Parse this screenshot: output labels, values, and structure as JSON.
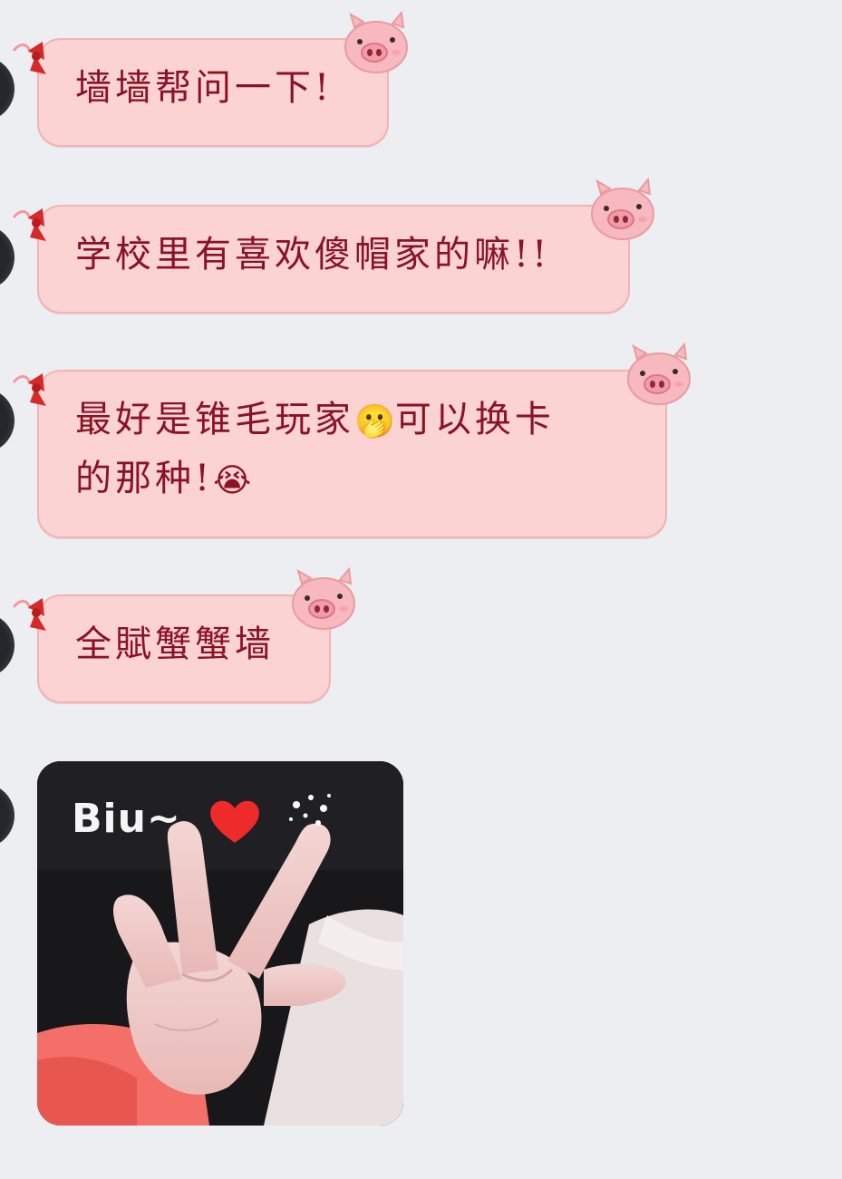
{
  "messages": [
    {
      "text": "墙墙帮问一下!"
    },
    {
      "text": "学校里有喜欢傻帽家的嘛!!"
    },
    {
      "text_before_emoji": "最好是锥毛玩家",
      "emoji1": "🫢",
      "text_mid": "可以换卡\n的那种!",
      "emoji2": "😭"
    },
    {
      "text": "全賦蟹蟹墙"
    }
  ],
  "image_message": {
    "caption": "Biu~",
    "heart_icon": "heart-icon",
    "sparkle_icon": "sparkle-icon",
    "subject": "hand making V / finger-heart gesture"
  },
  "decorations": {
    "bow_icon": "bow-icon",
    "pig_sticker": "pig-icon"
  },
  "colors": {
    "background": "#eceef2",
    "bubble_fill": "#fbd3d3",
    "bubble_border": "#f3b3b5",
    "text": "#8a1226",
    "bow": "#d42a2a",
    "pig": "#f7b9bf"
  }
}
